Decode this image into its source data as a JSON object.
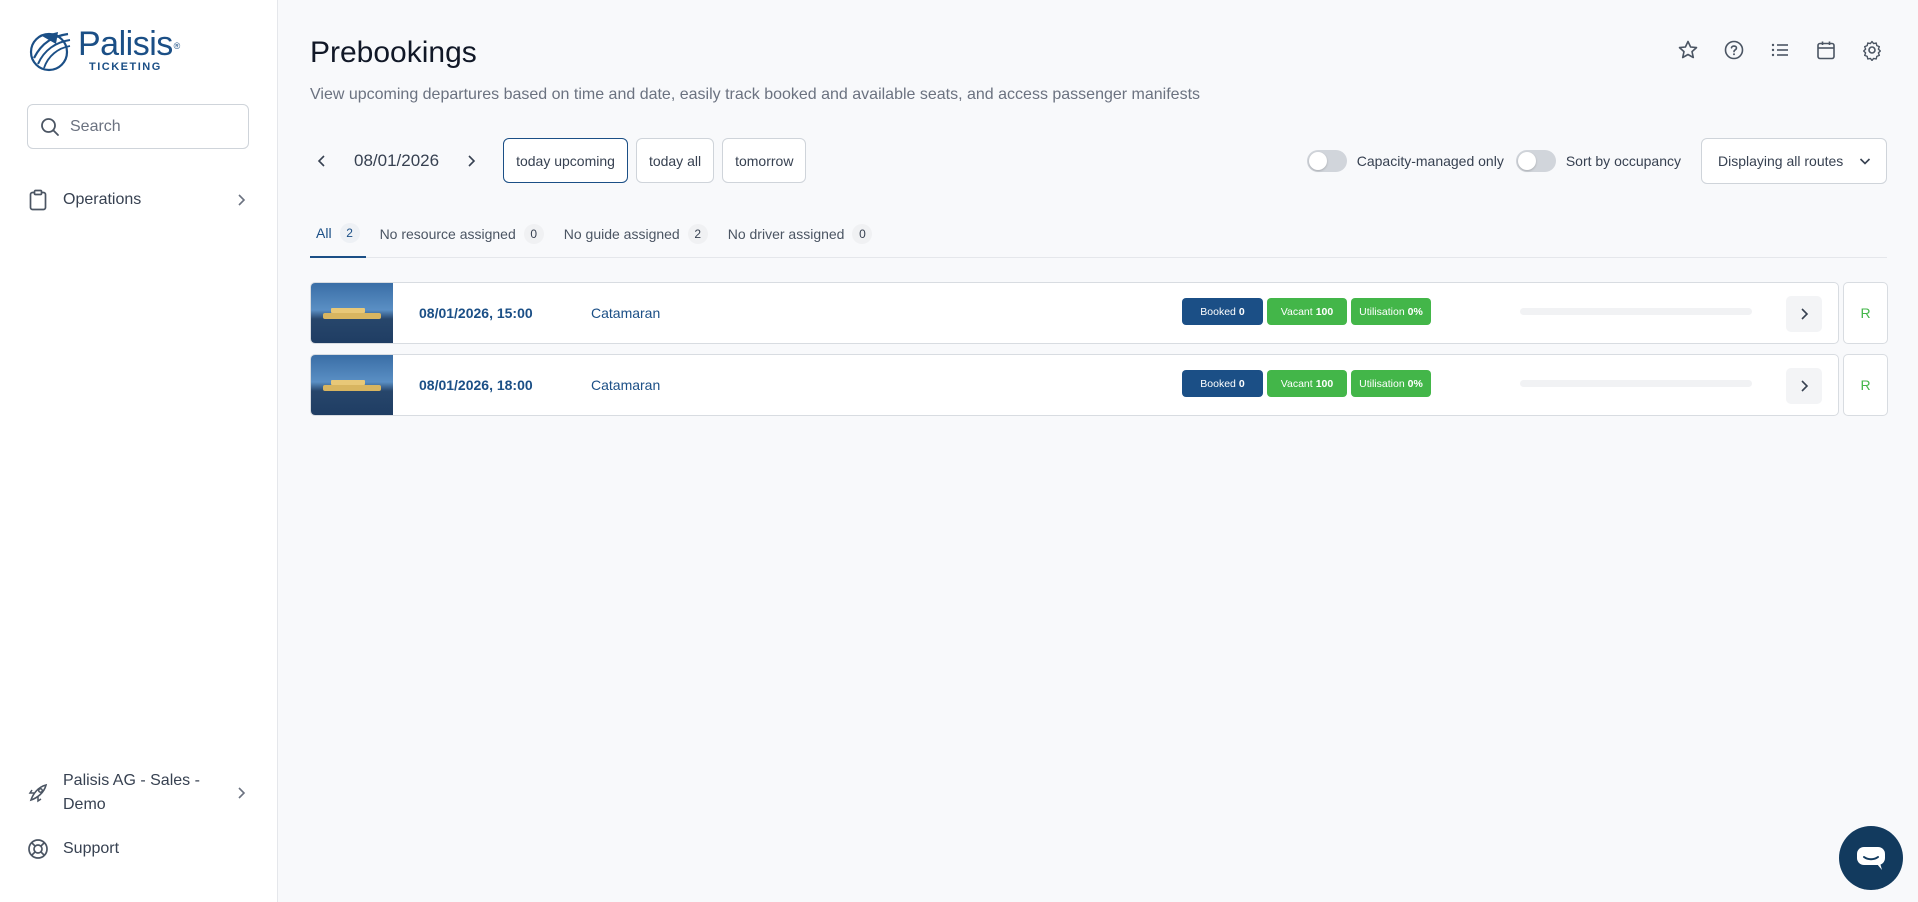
{
  "brand": {
    "name": "Palisis",
    "sub": "TICKETING",
    "reg": "®",
    "color": "#1b4f86"
  },
  "search": {
    "placeholder": "Search"
  },
  "sidebar": {
    "items": [
      {
        "label": "Operations",
        "icon": "clipboard-icon"
      }
    ],
    "bottom": [
      {
        "label": "Palisis AG - Sales - Demo",
        "icon": "rocket-icon"
      },
      {
        "label": "Support",
        "icon": "lifebuoy-icon"
      }
    ]
  },
  "header": {
    "title": "Prebookings",
    "description": "View upcoming departures based on time and date, easily track booked and available seats, and access passenger manifests",
    "icons": [
      "star-icon",
      "help-icon",
      "list-icon",
      "calendar-icon",
      "gear-icon"
    ]
  },
  "date_nav": {
    "date": "08/01/2026",
    "chips": [
      {
        "label": "today upcoming",
        "active": true
      },
      {
        "label": "today all",
        "active": false
      },
      {
        "label": "tomorrow",
        "active": false
      }
    ]
  },
  "filters": {
    "capacity_label": "Capacity-managed only",
    "capacity_on": false,
    "sort_label": "Sort by occupancy",
    "sort_on": false,
    "routes_label": "Displaying all routes"
  },
  "tabs": [
    {
      "label": "All",
      "count": "2",
      "active": true
    },
    {
      "label": "No resource assigned",
      "count": "0",
      "active": false
    },
    {
      "label": "No guide assigned",
      "count": "2",
      "active": false
    },
    {
      "label": "No driver assigned",
      "count": "0",
      "active": false
    }
  ],
  "departures": [
    {
      "time": "08/01/2026, 15:00",
      "vessel": "Catamaran",
      "booked_label": "Booked",
      "booked": "0",
      "vacant_label": "Vacant",
      "vacant": "100",
      "util_label": "Utilisation",
      "util": "0%",
      "progress": 0,
      "action": "R"
    },
    {
      "time": "08/01/2026, 18:00",
      "vessel": "Catamaran",
      "booked_label": "Booked",
      "booked": "0",
      "vacant_label": "Vacant",
      "vacant": "100",
      "util_label": "Utilisation",
      "util": "0%",
      "progress": 0,
      "action": "R"
    }
  ],
  "colors": {
    "booked": "#1b4f86",
    "vacant": "#43b649",
    "chat": "#123a5e"
  }
}
